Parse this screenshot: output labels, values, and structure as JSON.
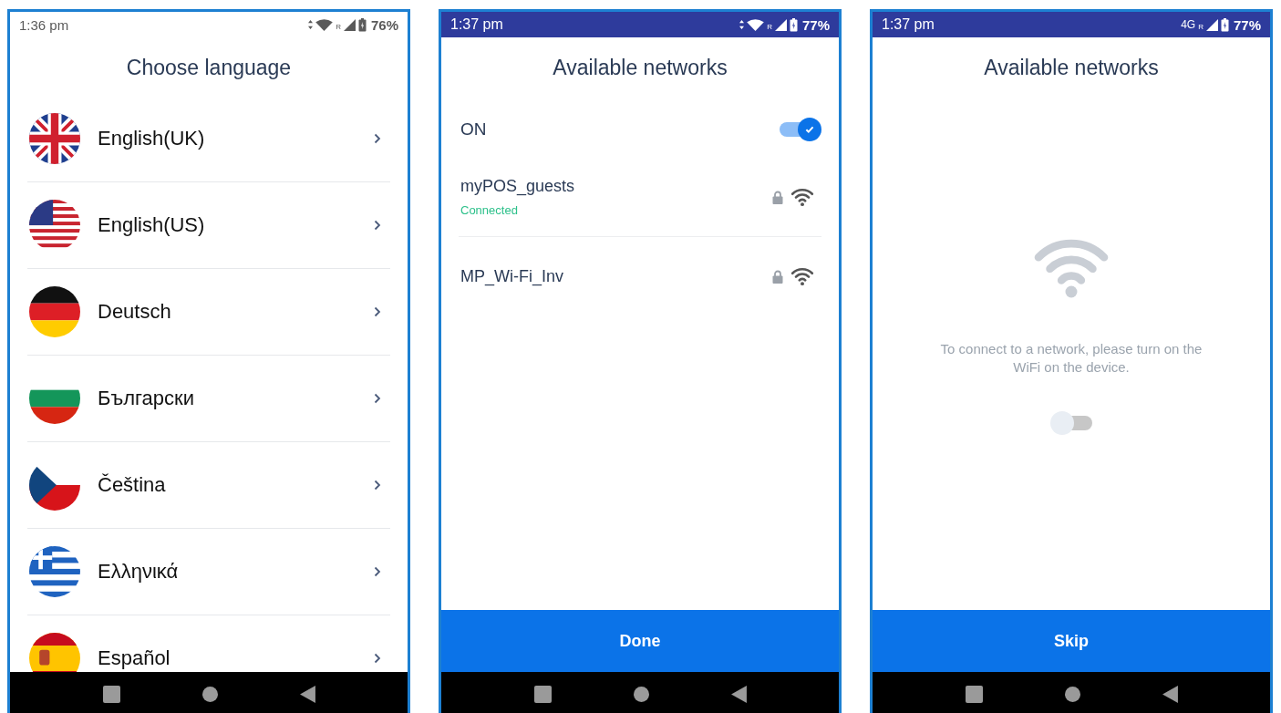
{
  "screens": [
    {
      "kind": "language",
      "status_bar": {
        "kind": "light",
        "time": "1:36 pm",
        "data_activity": true,
        "wifi": true,
        "roaming": "R",
        "battery": "76%"
      },
      "title": "Choose language",
      "languages": [
        {
          "name": "English(UK)",
          "kind": "uk"
        },
        {
          "name": "English(US)",
          "kind": "us"
        },
        {
          "name": "Deutsch",
          "kind": "de"
        },
        {
          "name": "Български",
          "kind": "bg"
        },
        {
          "name": "Čeština",
          "kind": "cz"
        },
        {
          "name": "Ελληνικά",
          "kind": "gr"
        },
        {
          "name": "Español",
          "kind": "es"
        }
      ]
    },
    {
      "kind": "networks",
      "status_bar": {
        "kind": "dark",
        "time": "1:37 pm",
        "data_activity": true,
        "wifi": true,
        "roaming": "R",
        "battery": "77%"
      },
      "title": "Available networks",
      "wifi_label": "ON",
      "wifi_on": true,
      "networks": [
        {
          "name": "myPOS_guests",
          "status": "Connected",
          "secured": true
        },
        {
          "name": "MP_Wi-Fi_Inv",
          "secured": true
        }
      ],
      "button": "Done"
    },
    {
      "kind": "no_wifi",
      "status_bar": {
        "kind": "dark",
        "time": "1:37 pm",
        "data_activity": false,
        "wifi": false,
        "network_type": "4G",
        "roaming": "R",
        "battery": "77%"
      },
      "title": "Available networks",
      "message": "To connect to a network, please turn on the WiFi on the device.",
      "wifi_on": false,
      "button": "Skip"
    }
  ]
}
